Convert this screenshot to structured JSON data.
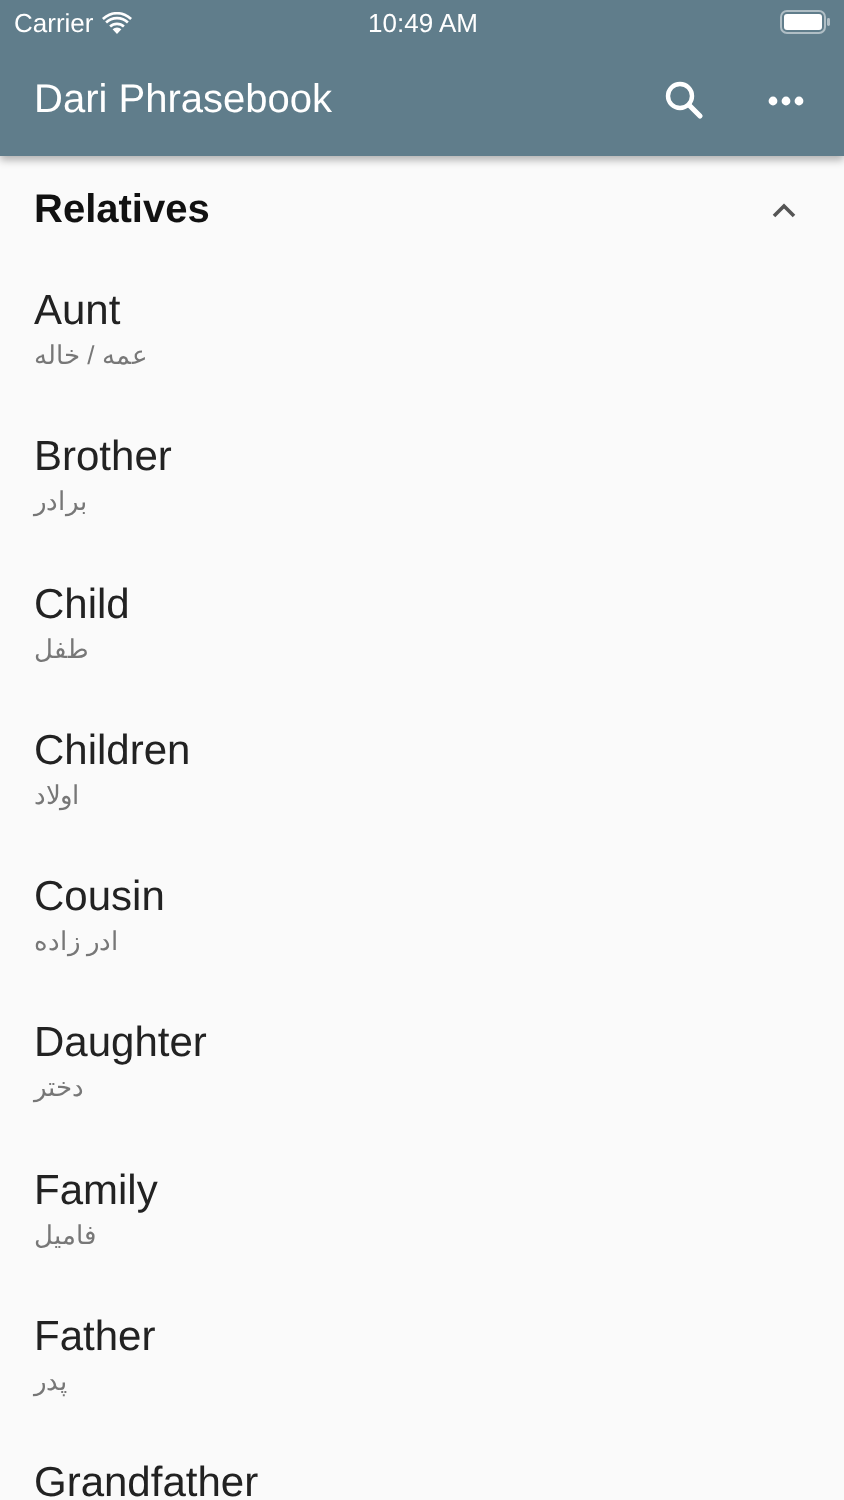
{
  "status_bar": {
    "carrier": "Carrier",
    "time": "10:49 AM"
  },
  "app_bar": {
    "title": "Dari Phrasebook"
  },
  "section": {
    "title": "Relatives",
    "expanded": true
  },
  "items": [
    {
      "english": "Aunt",
      "dari": "عمه / خاله"
    },
    {
      "english": "Brother",
      "dari": "برادر"
    },
    {
      "english": "Child",
      "dari": "طفل"
    },
    {
      "english": "Children",
      "dari": "اولاد"
    },
    {
      "english": "Cousin",
      "dari": "ادر زاده"
    },
    {
      "english": "Daughter",
      "dari": "دختر"
    },
    {
      "english": "Family",
      "dari": "فامیل"
    },
    {
      "english": "Father",
      "dari": "پدر"
    },
    {
      "english": "Grandfather"
    }
  ]
}
